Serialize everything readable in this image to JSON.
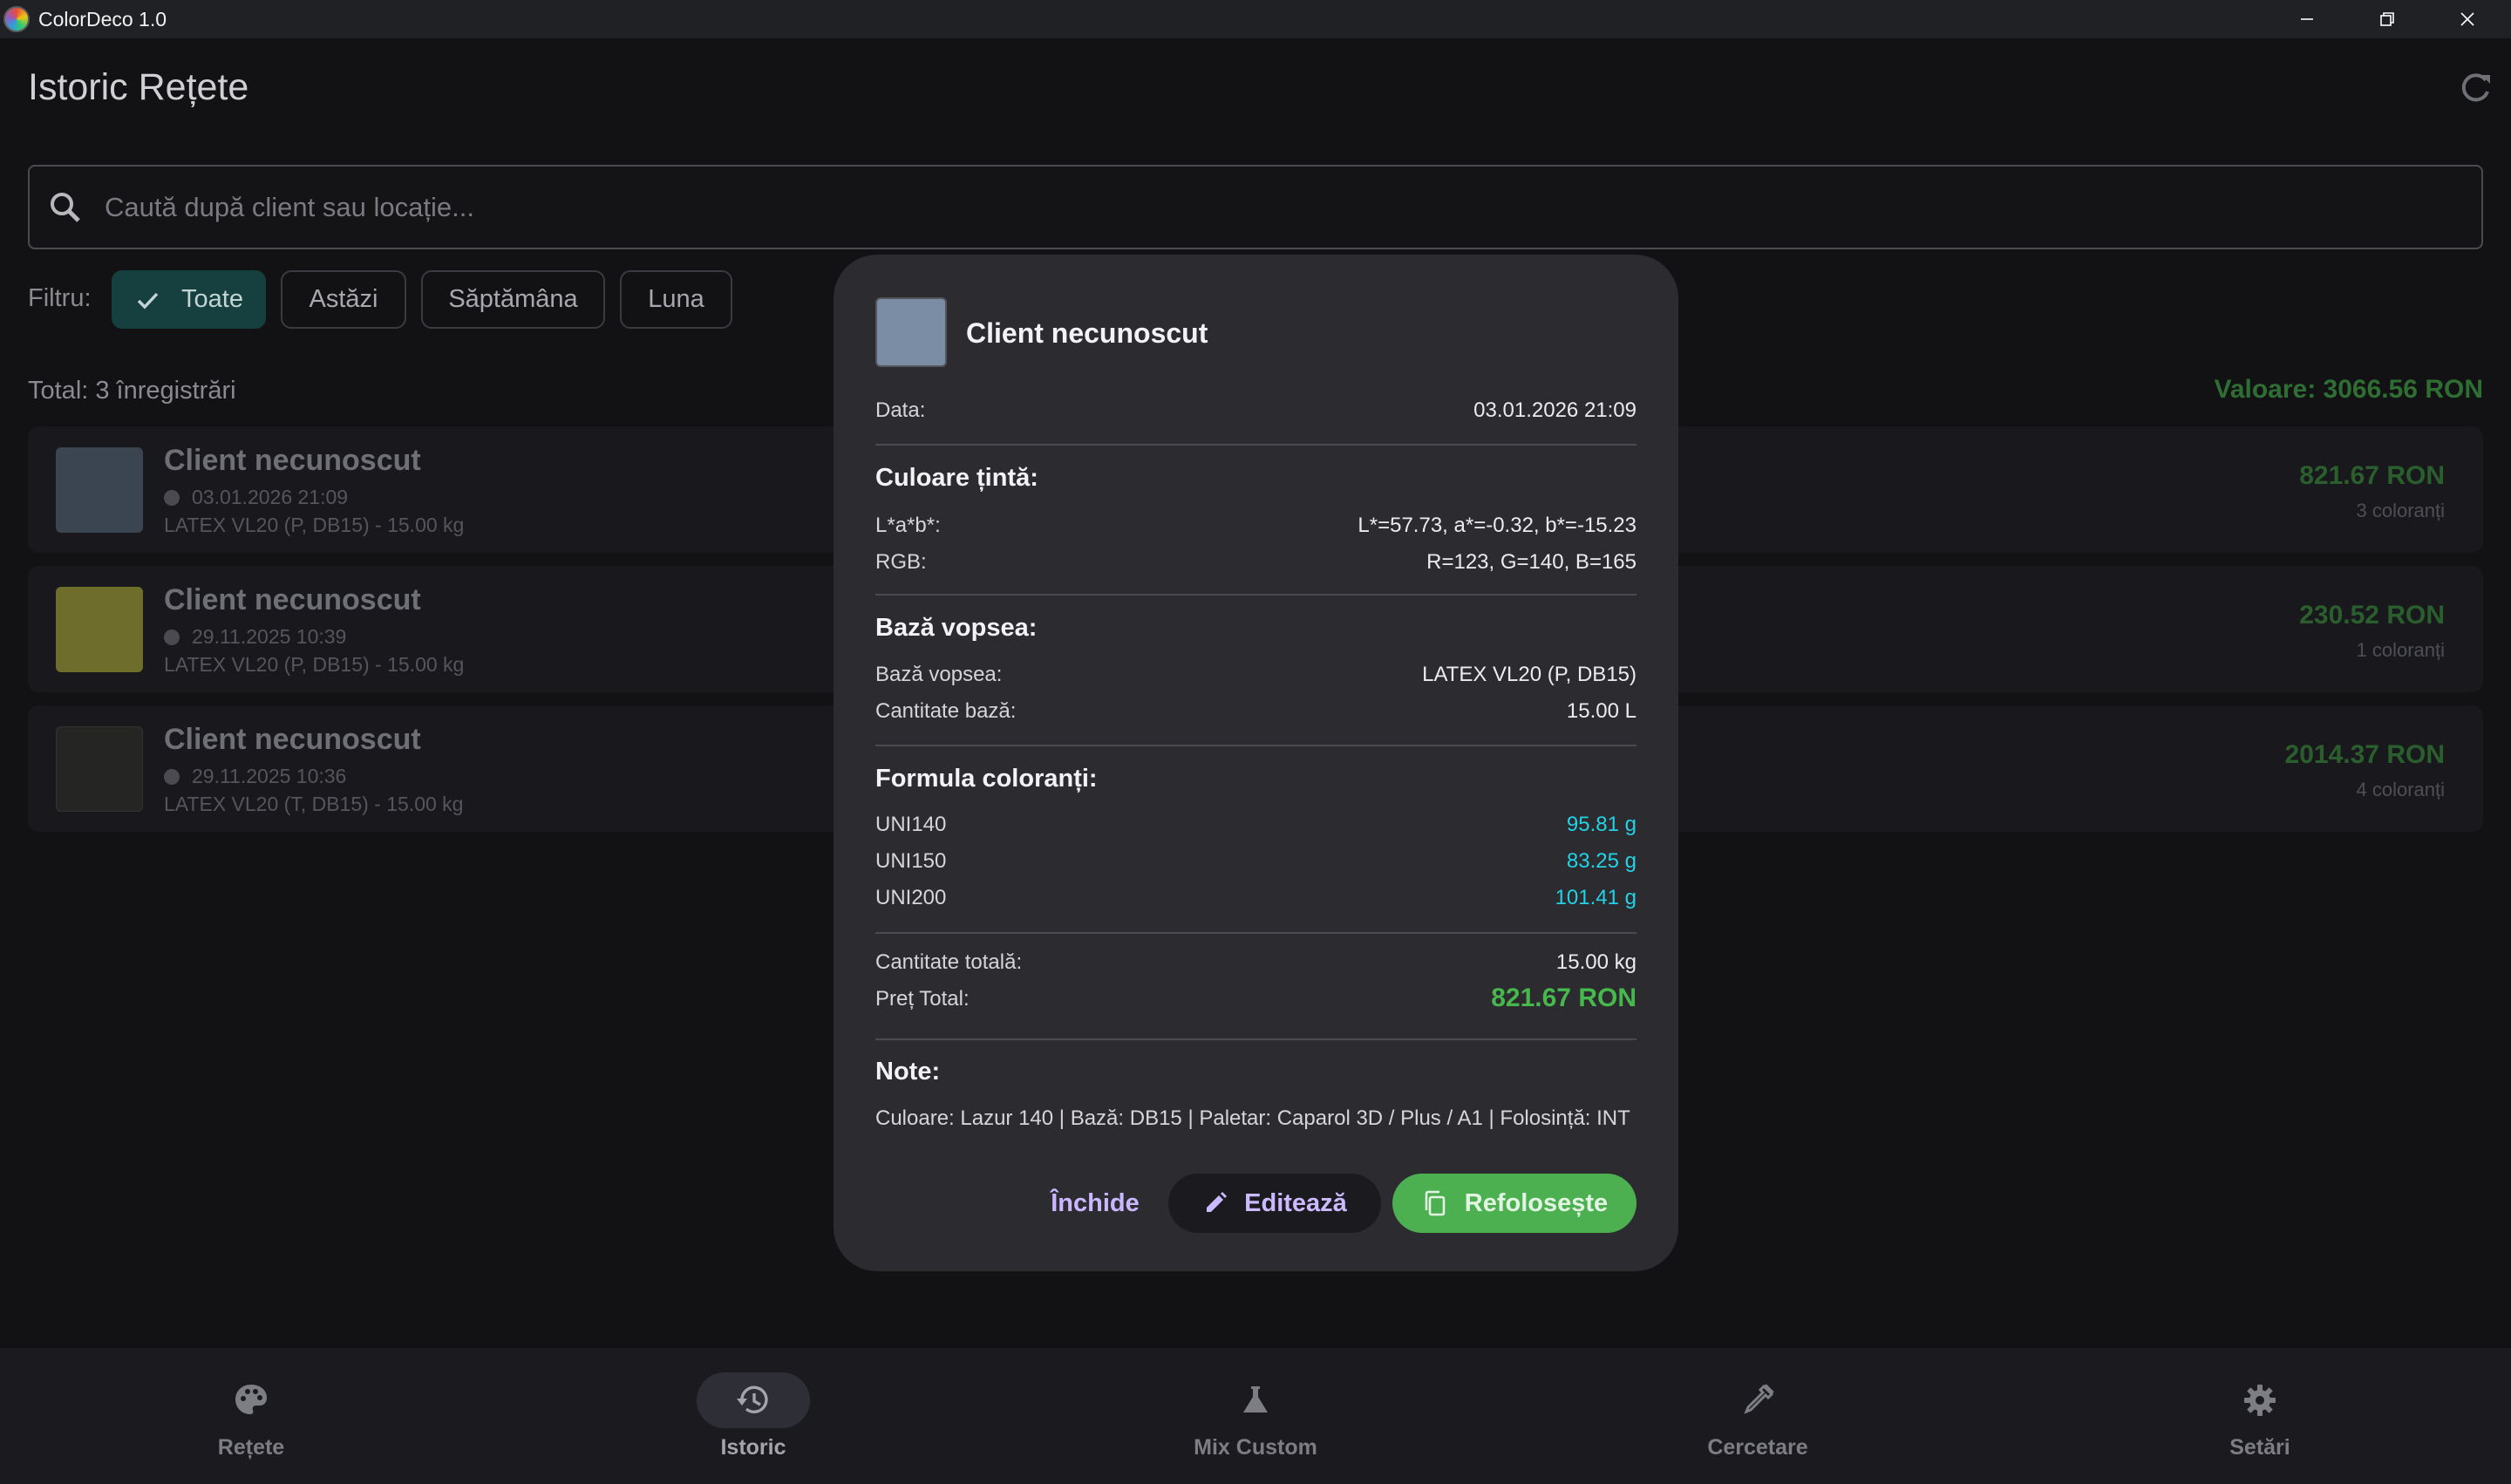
{
  "window": {
    "title": "ColorDeco 1.0"
  },
  "page": {
    "title": "Istoric Rețete",
    "search_placeholder": "Caută după client sau locație...",
    "filter_label": "Filtru:",
    "filters": [
      {
        "label": "Toate",
        "active": true
      },
      {
        "label": "Astăzi",
        "active": false
      },
      {
        "label": "Săptămâna",
        "active": false
      },
      {
        "label": "Luna",
        "active": false
      }
    ],
    "total_count": "Total: 3 înregistrări",
    "total_value": "Valoare: 3066.56 RON"
  },
  "records": [
    {
      "name": "Client necunoscut",
      "date": "03.01.2026 21:09",
      "base": "LATEX VL20 (P, DB15) - 15.00 kg",
      "price": "821.67 RON",
      "colorants": "3 coloranți",
      "swatch": "#3b4451"
    },
    {
      "name": "Client necunoscut",
      "date": "29.11.2025 10:39",
      "base": "LATEX VL20 (P, DB15) - 15.00 kg",
      "price": "230.52 RON",
      "colorants": "1 coloranți",
      "swatch": "#6e6d2c"
    },
    {
      "name": "Client necunoscut",
      "date": "29.11.2025 10:36",
      "base": "LATEX VL20 (T, DB15) - 15.00 kg",
      "price": "2014.37 RON",
      "colorants": "4 coloranți",
      "swatch": "#252524"
    }
  ],
  "dialog": {
    "title": "Client necunoscut",
    "swatch": "#7b8ca5",
    "date_label": "Data:",
    "date_value": "03.01.2026 21:09",
    "target_title": "Culoare țintă:",
    "lab_label": "L*a*b*:",
    "lab_value": "L*=57.73, a*=-0.32, b*=-15.23",
    "rgb_label": "RGB:",
    "rgb_value": "R=123, G=140, B=165",
    "base_title": "Bază vopsea:",
    "base_label": "Bază vopsea:",
    "base_value": "LATEX VL20 (P, DB15)",
    "base_qty_label": "Cantitate bază:",
    "base_qty_value": "15.00 L",
    "formula_title": "Formula coloranți:",
    "colorants": [
      {
        "name": "UNI140",
        "amount": "95.81 g"
      },
      {
        "name": "UNI150",
        "amount": "83.25 g"
      },
      {
        "name": "UNI200",
        "amount": "101.41 g"
      }
    ],
    "total_qty_label": "Cantitate totală:",
    "total_qty_value": "15.00 kg",
    "total_price_label": "Preț Total:",
    "total_price_value": "821.67 RON",
    "notes_title": "Note:",
    "notes_text": "Culoare: Lazur 140 | Bază: DB15 | Paletar: Caparol 3D / Plus / A1 | Folosință: INT",
    "btn_close": "Închide",
    "btn_edit": "Editează",
    "btn_reuse": "Refolosește"
  },
  "nav": [
    {
      "label": "Rețete",
      "icon": "palette-icon",
      "active": false
    },
    {
      "label": "Istoric",
      "icon": "history-icon",
      "active": true
    },
    {
      "label": "Mix Custom",
      "icon": "flask-icon",
      "active": false
    },
    {
      "label": "Cercetare",
      "icon": "eyedropper-icon",
      "active": false
    },
    {
      "label": "Setări",
      "icon": "gear-icon",
      "active": false
    }
  ]
}
